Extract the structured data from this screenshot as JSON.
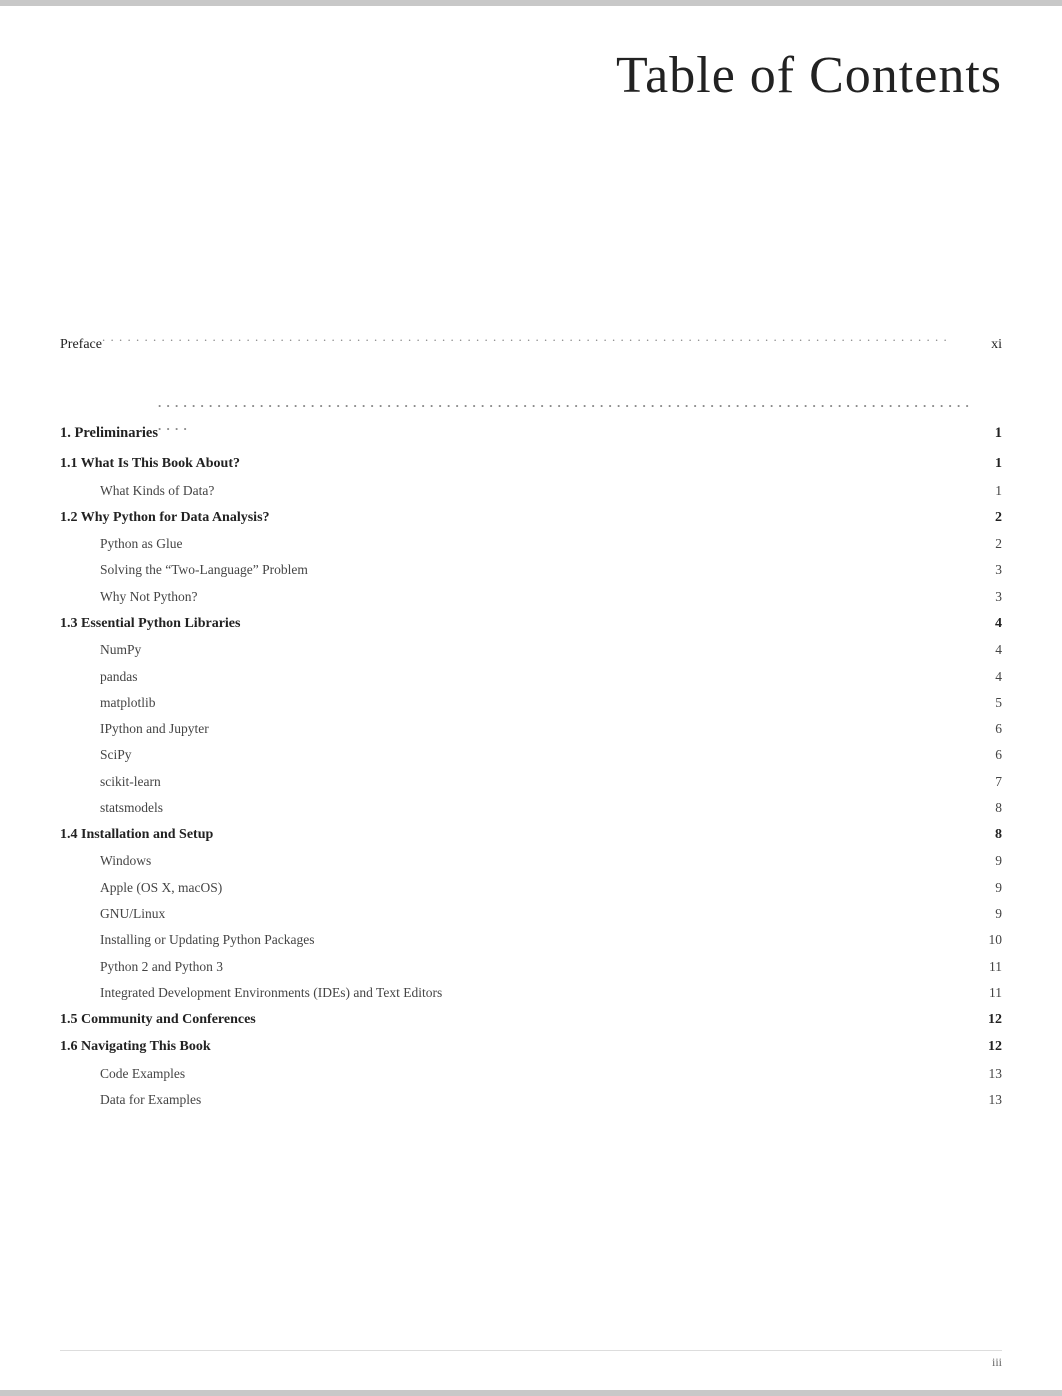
{
  "header": {
    "title": "Table of Contents"
  },
  "toc": {
    "entries": [
      {
        "type": "preface",
        "title": "Preface",
        "dots": true,
        "page": "xi"
      },
      {
        "type": "chapter",
        "title": "1.  Preliminaries",
        "dots": true,
        "page": "1"
      },
      {
        "type": "section",
        "title": "1.1 What Is This Book About?",
        "dots": false,
        "page": "1"
      },
      {
        "type": "subsection",
        "title": "What Kinds of Data?",
        "dots": false,
        "page": "1"
      },
      {
        "type": "section",
        "title": "1.2 Why Python for Data Analysis?",
        "dots": false,
        "page": "2"
      },
      {
        "type": "subsection",
        "title": "Python as Glue",
        "dots": false,
        "page": "2"
      },
      {
        "type": "subsection",
        "title": "Solving the “Two-Language” Problem",
        "dots": false,
        "page": "3"
      },
      {
        "type": "subsection",
        "title": "Why Not Python?",
        "dots": false,
        "page": "3"
      },
      {
        "type": "section",
        "title": "1.3 Essential Python Libraries",
        "dots": false,
        "page": "4"
      },
      {
        "type": "subsection",
        "title": "NumPy",
        "dots": false,
        "page": "4"
      },
      {
        "type": "subsection",
        "title": "pandas",
        "dots": false,
        "page": "4"
      },
      {
        "type": "subsection",
        "title": "matplotlib",
        "dots": false,
        "page": "5"
      },
      {
        "type": "subsection",
        "title": "IPython and Jupyter",
        "dots": false,
        "page": "6"
      },
      {
        "type": "subsection",
        "title": "SciPy",
        "dots": false,
        "page": "6"
      },
      {
        "type": "subsection",
        "title": "scikit-learn",
        "dots": false,
        "page": "7"
      },
      {
        "type": "subsection",
        "title": "statsmodels",
        "dots": false,
        "page": "8"
      },
      {
        "type": "section",
        "title": "1.4 Installation and Setup",
        "dots": false,
        "page": "8"
      },
      {
        "type": "subsection",
        "title": "Windows",
        "dots": false,
        "page": "9"
      },
      {
        "type": "subsection",
        "title": "Apple (OS X, macOS)",
        "dots": false,
        "page": "9"
      },
      {
        "type": "subsection",
        "title": "GNU/Linux",
        "dots": false,
        "page": "9"
      },
      {
        "type": "subsection",
        "title": "Installing or Updating Python Packages",
        "dots": false,
        "page": "10"
      },
      {
        "type": "subsection",
        "title": "Python 2 and Python 3",
        "dots": false,
        "page": "11"
      },
      {
        "type": "subsection",
        "title": "Integrated Development Environments (IDEs) and Text Editors",
        "dots": false,
        "page": "11"
      },
      {
        "type": "section",
        "title": "1.5 Community and Conferences",
        "dots": false,
        "page": "12"
      },
      {
        "type": "section",
        "title": "1.6 Navigating This Book",
        "dots": false,
        "page": "12"
      },
      {
        "type": "subsection",
        "title": "Code Examples",
        "dots": false,
        "page": "13"
      },
      {
        "type": "subsection",
        "title": "Data for Examples",
        "dots": false,
        "page": "13"
      }
    ]
  },
  "footer": {
    "page_number": "iii"
  }
}
